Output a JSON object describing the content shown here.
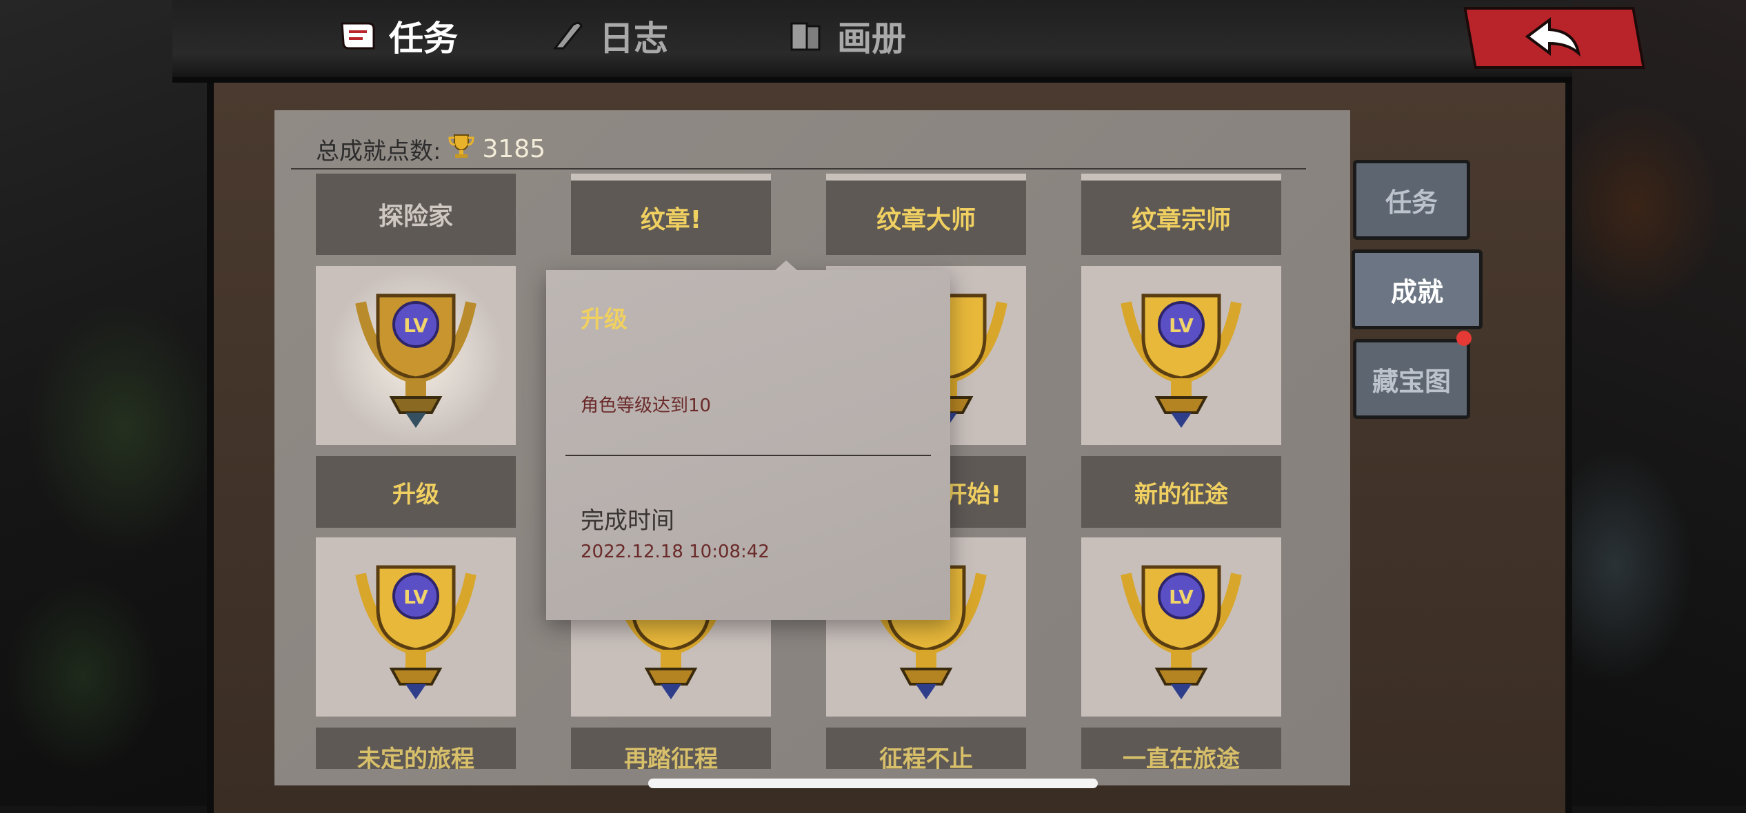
{
  "colors": {
    "accent_red": "#b8242a",
    "gold_text": "#f0d060",
    "dark_red_text": "#6a2a2a"
  },
  "top_tabs": [
    {
      "label": "任务",
      "icon": "scroll-icon",
      "active": true
    },
    {
      "label": "日志",
      "icon": "quill-icon",
      "active": false
    },
    {
      "label": "画册",
      "icon": "book-icon",
      "active": false
    }
  ],
  "back_button": {
    "icon": "back-arrow-icon"
  },
  "summary": {
    "label": "总成就点数:",
    "value": "3185",
    "icon": "trophy-icon"
  },
  "achievements": {
    "headers": [
      "探险家",
      "纹章!",
      "纹章大师",
      "纹章宗师"
    ],
    "row1": [
      "升级",
      "",
      "开始!",
      "新的征途"
    ],
    "row2": [
      "未定的旅程",
      "再踏征程",
      "征程不止",
      "一直在旅途"
    ]
  },
  "side_tabs": [
    {
      "label": "任务",
      "active": false
    },
    {
      "label": "成就",
      "active": true
    },
    {
      "label": "藏宝图",
      "active": false,
      "badge": true
    }
  ],
  "popup": {
    "title": "升级",
    "description": "角色等级达到10",
    "completion_label": "完成时间",
    "completion_time": "2022.12.18 10:08:42"
  }
}
